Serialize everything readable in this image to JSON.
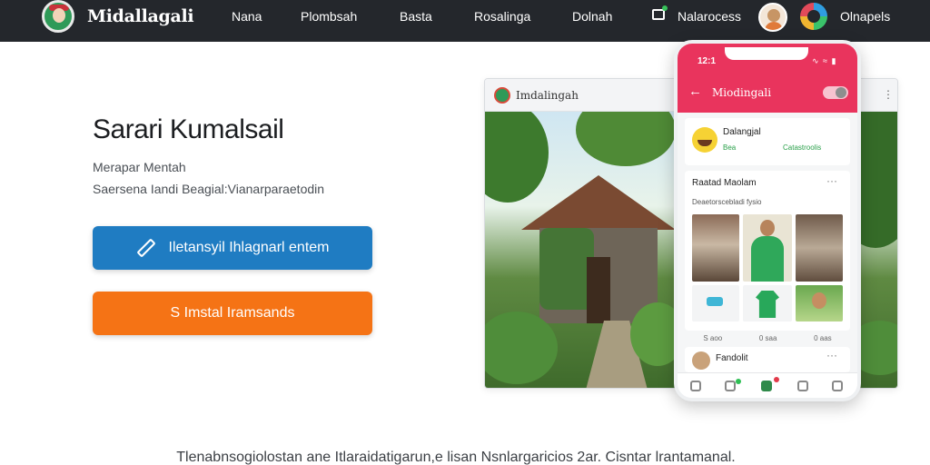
{
  "nav": {
    "brand": "Midallagali",
    "links": [
      "Nana",
      "Plombsah",
      "Basta",
      "Rosalinga",
      "Dolnah"
    ],
    "messages_label": "Nalarocess",
    "account_label": "Olnapels"
  },
  "hero": {
    "title": "Sarari Kumalsail",
    "subtitle_line1": "Merapar Mentah",
    "subtitle_line2": "Saersena Iandi Beagial:Vianarparaetodin",
    "primary_button": "Iletansyil Ihlagnarl entem",
    "secondary_button": "S Imstal Iramsands"
  },
  "browser": {
    "tab_title": "Imdalingah",
    "menu_dots": "⋮"
  },
  "phone": {
    "status_time": "12:1",
    "signal": "∿ ≈ ▮",
    "app_title": "Miodingali",
    "back": "←",
    "card1_name": "Dalangjal",
    "card1_sub": "Bea",
    "card1_action": "Catastroolis",
    "card2_title": "Raatad Maolam",
    "card2_sub": "Deaetorscebladi fysio",
    "card2_dots": "···",
    "captions": [
      "S aoo",
      "0 saa",
      "0 aas"
    ],
    "card3_name": "Fandolit",
    "card3_dots": "···"
  },
  "footer": {
    "text": "Tlenabnsogiolostan ane Itlaraidatigarun,e lisan Nsnlargaricios 2ar. Cisntar lrantamanal."
  },
  "colors": {
    "nav_bg": "#24272c",
    "primary_blue": "#1f7cc2",
    "accent_orange": "#f57315",
    "app_pink": "#e9345d",
    "green": "#2fa85a"
  }
}
